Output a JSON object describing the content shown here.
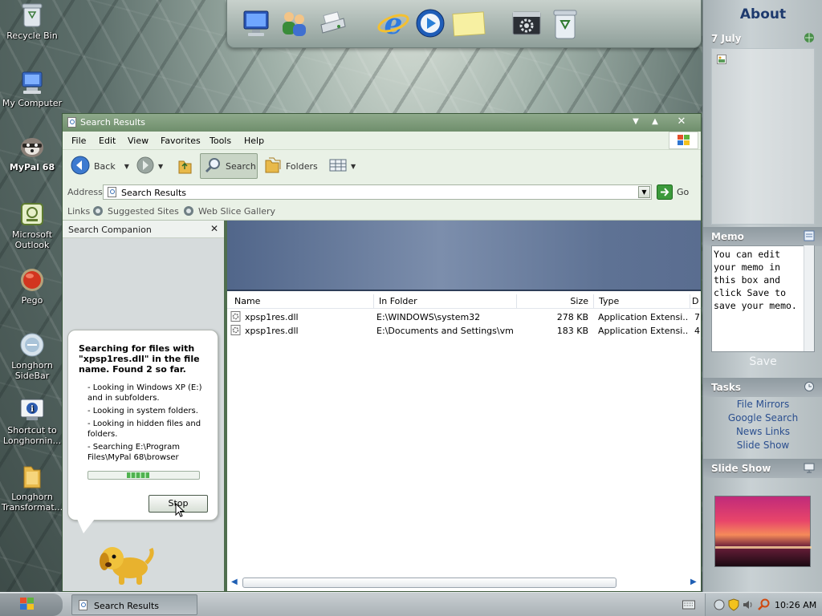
{
  "desktop": {
    "icons": [
      {
        "label": "Recycle Bin",
        "icon": "recycle-bin-icon"
      },
      {
        "label": "My Computer",
        "icon": "my-computer-icon"
      },
      {
        "label": "MyPal 68",
        "icon": "raccoon-icon"
      },
      {
        "label": "Microsoft Outlook",
        "icon": "outlook-icon"
      },
      {
        "label": "Pego",
        "icon": "red-orb-icon"
      },
      {
        "label": "Longhorn SideBar",
        "icon": "sidebar-icon"
      },
      {
        "label": "Shortcut to Longhornin...",
        "icon": "info-icon"
      },
      {
        "label": "Longhorn Transformat...",
        "icon": "folder-icon"
      }
    ]
  },
  "dock": {
    "items": [
      "monitor-icon",
      "users-icon",
      "scanner-icon",
      "ie-icon",
      "media-player-icon",
      "sticky-note-icon",
      "control-panel-icon",
      "recycle-bin-icon"
    ]
  },
  "sidebar": {
    "about_title": "About",
    "date": "7 July",
    "memo": {
      "title": "Memo",
      "text": "You can edit your memo in this box and click Save to save your memo.",
      "save_label": "Save"
    },
    "tasks": {
      "title": "Tasks",
      "links": [
        "File Mirrors",
        "Google Search",
        "News Links",
        "Slide Show"
      ]
    },
    "slideshow": {
      "title": "Slide Show"
    }
  },
  "window": {
    "title": "Search Results",
    "menu": [
      "File",
      "Edit",
      "View",
      "Favorites",
      "Tools",
      "Help"
    ],
    "toolbar": {
      "back": "Back",
      "search": "Search",
      "folders": "Folders"
    },
    "address": {
      "label": "Address",
      "value": "Search Results",
      "go": "Go"
    },
    "links": {
      "label": "Links",
      "items": [
        "Suggested Sites",
        "Web Slice Gallery"
      ]
    },
    "companion": {
      "title": "Search Companion",
      "heading": "Searching for files with \"xpsp1res.dll\" in the file name.  Found 2 so far.",
      "steps": [
        "- Looking in Windows XP (E:) and in subfolders.",
        "- Looking in system folders.",
        "- Looking in hidden files and folders.",
        "- Searching E:\\Program Files\\MyPal 68\\browser"
      ],
      "progress": 0.35,
      "stop_label": "Stop"
    },
    "columns": [
      "Name",
      "In Folder",
      "Size",
      "Type",
      "D"
    ],
    "rows": [
      {
        "name": "xpsp1res.dll",
        "folder": "E:\\WINDOWS\\system32",
        "size": "278 KB",
        "type": "Application Extensi...",
        "extra": "7"
      },
      {
        "name": "xpsp1res.dll",
        "folder": "E:\\Documents and Settings\\vm...",
        "size": "183 KB",
        "type": "Application Extensi...",
        "extra": "4"
      }
    ]
  },
  "taskbar": {
    "task_label": "Search Results",
    "clock": "10:26 AM"
  },
  "colors": {
    "window_frame": "#4f6e4e",
    "window_bar": "#e9f1e6",
    "companion_bg": "#d6dbdc",
    "sidebar_accent": "#2b4f8f"
  }
}
